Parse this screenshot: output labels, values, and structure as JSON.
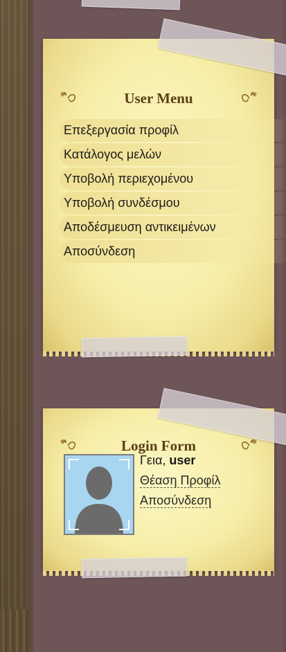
{
  "user_menu": {
    "title": "User Menu",
    "items": [
      {
        "label": "Επεξεργασία προφίλ"
      },
      {
        "label": "Κατάλογος μελών"
      },
      {
        "label": "Υποβολή περιεχομένου"
      },
      {
        "label": "Υποβολή συνδέσμου"
      },
      {
        "label": "Αποδέσμευση αντικειμένων"
      },
      {
        "label": "Αποσύνδεση"
      }
    ]
  },
  "login_form": {
    "title": "Login Form",
    "greeting_prefix": "Γεια,",
    "username": "user",
    "view_profile": "Θέαση Προφίλ",
    "logout": "Αποσύνδεση"
  },
  "colors": {
    "note_paper": "#f6eea8",
    "column_bg": "#6e5558",
    "title_text": "#5a3e16",
    "avatar_bg": "#a8d6f0"
  },
  "icons": {
    "title_ornament": "flourish-ornament-icon",
    "avatar": "user-silhouette-icon"
  }
}
